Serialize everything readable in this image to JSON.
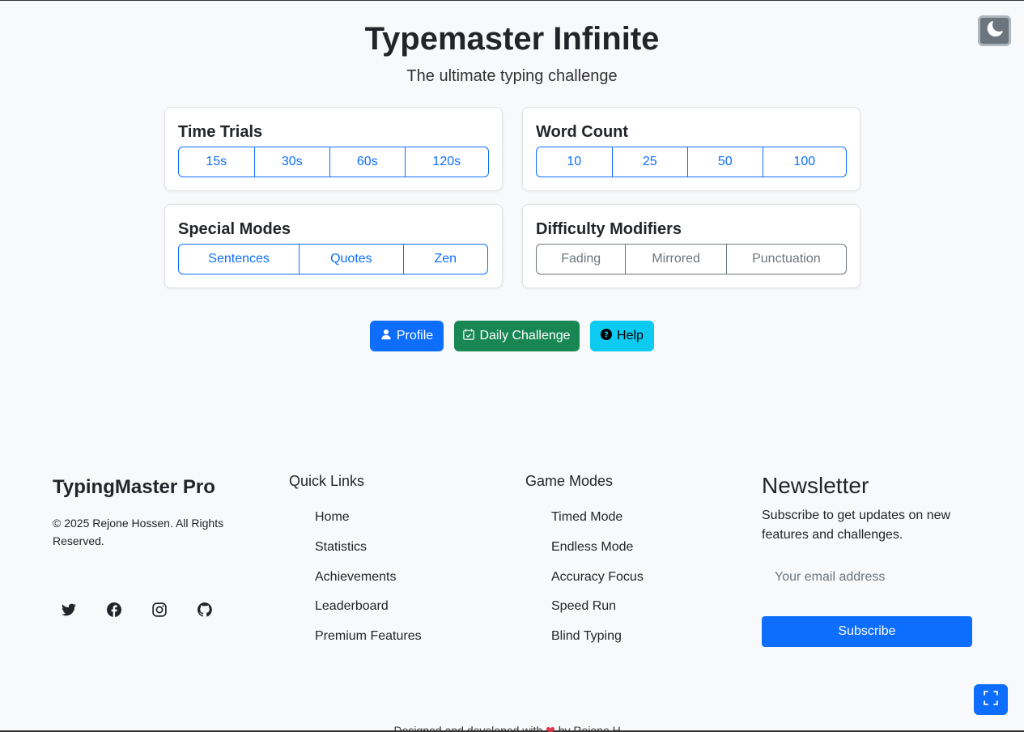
{
  "header": {
    "title": "Typemaster Infinite",
    "subtitle": "The ultimate typing challenge"
  },
  "cards": {
    "time_trials": {
      "title": "Time Trials",
      "options": [
        "15s",
        "30s",
        "60s",
        "120s"
      ]
    },
    "word_count": {
      "title": "Word Count",
      "options": [
        "10",
        "25",
        "50",
        "100"
      ]
    },
    "special_modes": {
      "title": "Special Modes",
      "options": [
        "Sentences",
        "Quotes",
        "Zen"
      ]
    },
    "difficulty": {
      "title": "Difficulty Modifiers",
      "options": [
        "Fading",
        "Mirrored",
        "Punctuation"
      ]
    }
  },
  "actions": {
    "profile": "Profile",
    "daily": "Daily Challenge",
    "help": "Help"
  },
  "footer": {
    "brand": "TypingMaster Pro",
    "copyright": "© 2025 Rejone Hossen. All Rights Reserved.",
    "quick_links": {
      "heading": "Quick Links",
      "items": [
        "Home",
        "Statistics",
        "Achievements",
        "Leaderboard",
        "Premium Features"
      ]
    },
    "game_modes": {
      "heading": "Game Modes",
      "items": [
        "Timed Mode",
        "Endless Mode",
        "Accuracy Focus",
        "Speed Run",
        "Blind Typing"
      ]
    },
    "newsletter": {
      "heading": "Newsletter",
      "text": "Subscribe to get updates on new features and challenges.",
      "placeholder": "Your email address",
      "button": "Subscribe"
    },
    "credit_prefix": "Designed and developed with",
    "credit_suffix": "by Rejone H..."
  },
  "icons": {
    "theme": "moon-icon",
    "profile": "person-icon",
    "daily": "calendar-check-icon",
    "help": "question-circle-icon",
    "social": [
      "twitter-icon",
      "facebook-icon",
      "instagram-icon",
      "github-icon"
    ],
    "fullscreen": "fullscreen-icon"
  },
  "colors": {
    "primary": "#0d6efd",
    "success": "#198754",
    "info": "#0dcaf0",
    "secondary": "#6c757d",
    "background": "#f8f9fa"
  }
}
